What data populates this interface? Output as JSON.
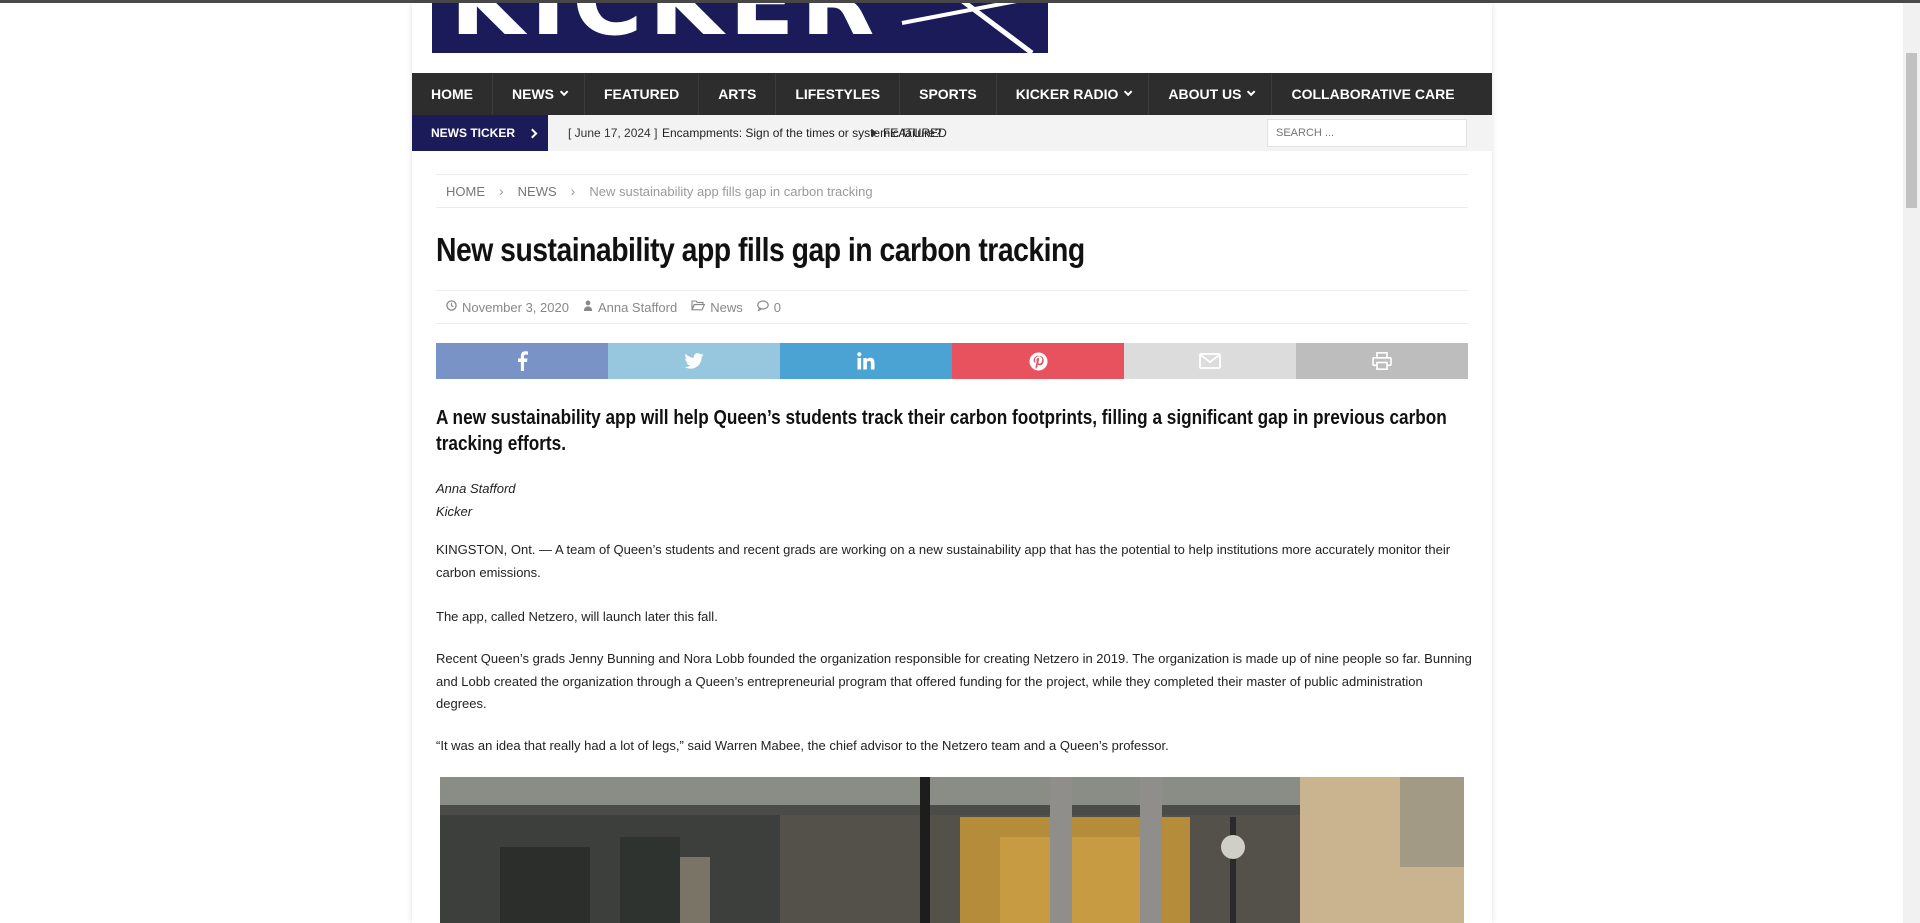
{
  "nav": {
    "items": [
      {
        "label": "HOME",
        "caret": false
      },
      {
        "label": "NEWS",
        "caret": true
      },
      {
        "label": "FEATURED",
        "caret": false
      },
      {
        "label": "ARTS",
        "caret": false
      },
      {
        "label": "LIFESTYLES",
        "caret": false
      },
      {
        "label": "SPORTS",
        "caret": false
      },
      {
        "label": "KICKER RADIO",
        "caret": true
      },
      {
        "label": "ABOUT US",
        "caret": true
      },
      {
        "label": "COLLABORATIVE CARE",
        "caret": false
      }
    ]
  },
  "ticker": {
    "label": "NEWS TICKER",
    "date": "[ June 17, 2024 ]",
    "headline": "Encampments: Sign of the times or systemic failure?",
    "category": "FEATURED"
  },
  "search": {
    "placeholder": "SEARCH ..."
  },
  "breadcrumb": {
    "home": "HOME",
    "section": "NEWS",
    "current": "New sustainability app fills gap in carbon tracking"
  },
  "article": {
    "title": "New sustainability app fills gap in carbon tracking",
    "meta": {
      "date": "November 3, 2020",
      "author": "Anna Stafford",
      "category": "News",
      "comments": "0"
    },
    "lead": "A new sustainability app will help Queen’s students track their carbon footprints, filling a significant gap in previous carbon tracking efforts.",
    "byline_name": "Anna Stafford",
    "byline_pub": "Kicker",
    "paragraphs": [
      "KINGSTON, Ont. — A team of Queen’s students and recent grads are working on a new sustainability app that has the potential to help institutions more accurately monitor their carbon emissions.",
      "The app, called Netzero, will launch later this fall.",
      "Recent Queen’s grads Jenny Bunning and Nora Lobb founded the organization responsible for creating Netzero in 2019. The organization is made up of nine people so far. Bunning and Lobb created the organization through a Queen’s entrepreneurial program that offered funding for the project, while they completed their master of public administration degrees.",
      "“It was an idea that really had a lot of legs,” said Warren Mabee, the chief advisor to the Netzero team and a Queen’s professor."
    ]
  },
  "share": [
    {
      "icon": "facebook-icon",
      "color": "#7a93c6"
    },
    {
      "icon": "twitter-icon",
      "color": "#97c6df"
    },
    {
      "icon": "linkedin-icon",
      "color": "#4ba3d3"
    },
    {
      "icon": "pinterest-icon",
      "color": "#e8525f"
    },
    {
      "icon": "email-icon",
      "color": "#dcdcdc"
    },
    {
      "icon": "print-icon",
      "color": "#bdbdbd"
    }
  ],
  "colors": {
    "brand_navy": "#1b1b5a",
    "nav_bg": "#2d2d2d"
  }
}
